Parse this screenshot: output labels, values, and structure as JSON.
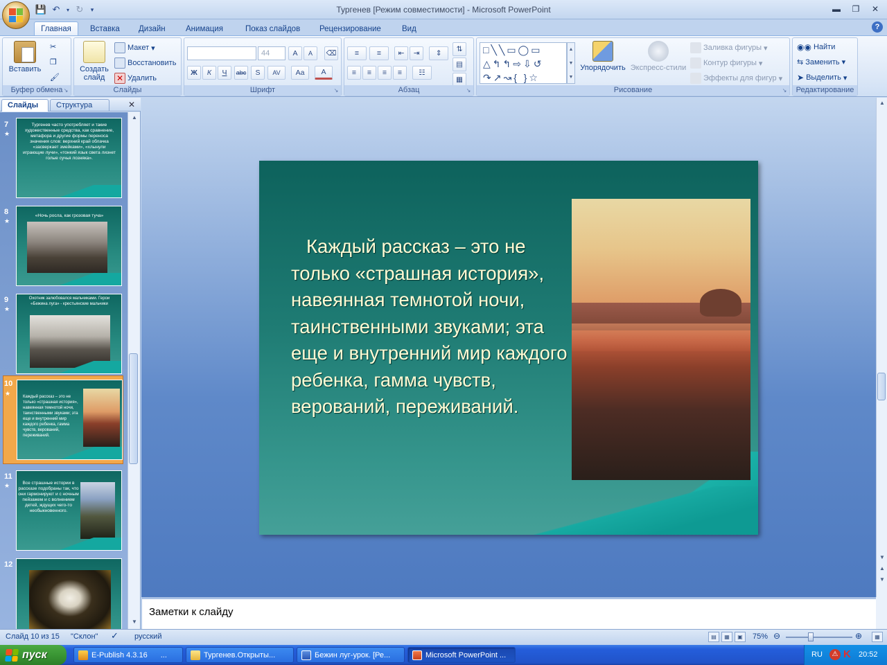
{
  "window": {
    "title": "Тургенев [Режим совместимости] - Microsoft PowerPoint"
  },
  "tabs": [
    "Главная",
    "Вставка",
    "Дизайн",
    "Анимация",
    "Показ слайдов",
    "Рецензирование",
    "Вид"
  ],
  "ribbon": {
    "clipboard": {
      "label": "Буфер обмена",
      "paste": "Вставить"
    },
    "slides": {
      "label": "Слайды",
      "new_slide": "Создать слайд",
      "layout": "Макет",
      "reset": "Восстановить",
      "delete": "Удалить"
    },
    "font": {
      "label": "Шрифт",
      "font_name": "",
      "font_size": "44",
      "bold": "Ж",
      "italic": "К",
      "underline": "Ч",
      "strike": "abc",
      "shadow": "S",
      "spacing": "AV",
      "case": "Aa",
      "color": "A",
      "grow": "A",
      "shrink": "A"
    },
    "paragraph": {
      "label": "Абзац"
    },
    "drawing": {
      "label": "Рисование",
      "arrange": "Упорядочить",
      "quick_styles": "Экспресс-стили",
      "fill": "Заливка фигуры",
      "outline": "Контур фигуры",
      "effects": "Эффекты для фигур"
    },
    "editing": {
      "label": "Редактирование",
      "find": "Найти",
      "replace": "Заменить",
      "select": "Выделить"
    }
  },
  "left_panel": {
    "tabs": [
      "Слайды",
      "Структура"
    ],
    "thumbnails": [
      {
        "num": "7",
        "text": "Тургенев часто употребляет и такие художественные средства, как сравнение, метафора и другие формы переноса значения слов: верхний край облачка «засверкает змейками», «хлынули играющие лучи», «тонкий язык света лизнет голые сучья лозняка»."
      },
      {
        "num": "8",
        "text": "«Ночь росла, как грозовая туча»"
      },
      {
        "num": "9",
        "text": "Охотник залюбовался мальчиками. Герои «Бежина луга» - крестьянские мальчики"
      },
      {
        "num": "10",
        "text": "Каждый рассказ – это не только «страшная история», навеянная темнотой ночи, таинственными звуками; эта еще и внутренний мир каждого ребенка, гамма чувств, верований, переживаний."
      },
      {
        "num": "11",
        "text": "Все страшные истории в рассказе подобраны так, что они гармонируют и с ночным пейзажем и с волнением детей, ждущих чего-то необыкновенного."
      },
      {
        "num": "12",
        "text": ""
      }
    ]
  },
  "slide": {
    "text": "Каждый рассказ – это не только «страшная история», навеянная темнотой ночи, таинственными звуками; эта еще и внутренний мир каждого ребенка, гамма чувств, верований, переживаний."
  },
  "notes": {
    "placeholder": "Заметки к слайду"
  },
  "status": {
    "slide": "Слайд 10 из 15",
    "theme": "\"Склон\"",
    "language": "русский",
    "zoom": "75%"
  },
  "taskbar": {
    "start": "пуск",
    "tasks": [
      "E-Publish 4.3.16",
      "...",
      "Тургенев.Открыты...",
      "Бежин луг-урок. [Ре...",
      "Microsoft PowerPoint ..."
    ],
    "lang": "RU",
    "clock": "20:52"
  }
}
